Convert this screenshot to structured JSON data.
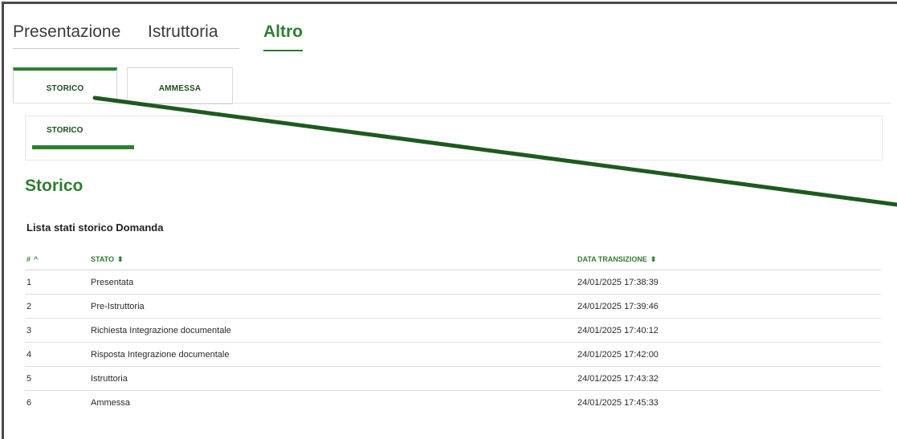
{
  "top_tabs": [
    {
      "label": "Presentazione",
      "active": false
    },
    {
      "label": "Istruttoria",
      "active": false
    },
    {
      "label": "Altro",
      "active": true
    }
  ],
  "subtabs": [
    {
      "label": "STORICO",
      "active": true
    },
    {
      "label": "AMMESSA",
      "active": false
    }
  ],
  "inner_nav": {
    "label": "STORICO"
  },
  "section_title": "Storico",
  "list_title": "Lista stati storico Domanda",
  "table": {
    "headers": {
      "num": "#",
      "num_sort_icon": "^",
      "stato": "STATO",
      "stato_sort_icon": "⬍",
      "data": "DATA TRANSIZIONE",
      "data_sort_icon": "⬍"
    },
    "rows": [
      {
        "num": "1",
        "stato": "Presentata",
        "data": "24/01/2025 17:38:39"
      },
      {
        "num": "2",
        "stato": "Pre-Istruttoria",
        "data": "24/01/2025 17:39:46"
      },
      {
        "num": "3",
        "stato": "Richiesta Integrazione documentale",
        "data": "24/01/2025 17:40:12"
      },
      {
        "num": "4",
        "stato": "Risposta Integrazione documentale",
        "data": "24/01/2025 17:42:00"
      },
      {
        "num": "5",
        "stato": "Istruttoria",
        "data": "24/01/2025 17:43:32"
      },
      {
        "num": "6",
        "stato": "Ammessa",
        "data": "24/01/2025 17:45:33"
      }
    ]
  },
  "colors": {
    "accent": "#2f7d32",
    "annotation_line": "#1e5a1e"
  }
}
